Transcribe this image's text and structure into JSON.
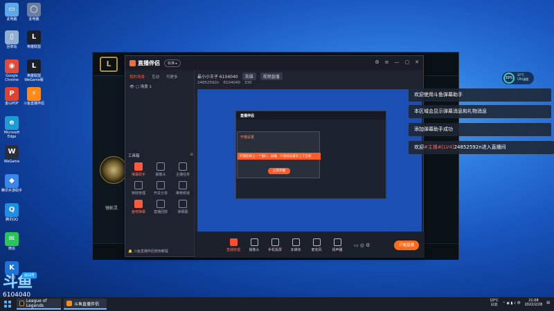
{
  "desktop": {
    "icons": [
      {
        "label": "此电脑",
        "color": "#5fa8e8",
        "glyph": "▭"
      },
      {
        "label": "此电脑",
        "color": "#6a7ea0",
        "glyph": "◯"
      },
      {
        "label": "回收站",
        "color": "#8fb0d0",
        "glyph": "▯"
      },
      {
        "label": "英雄联盟",
        "color": "#1b1f2a",
        "glyph": "L"
      },
      {
        "label": "Google Chrome",
        "color": "#e04a3a",
        "glyph": "◉"
      },
      {
        "label": "英雄联盟WeGame版",
        "color": "#1b1f2a",
        "glyph": "L"
      },
      {
        "label": "金山PDF",
        "color": "#e0432d",
        "glyph": "P"
      },
      {
        "label": "斗鱼直播伴侣",
        "color": "#ff8a1a",
        "glyph": "⚡"
      },
      {
        "label": "Microsoft Edge",
        "color": "#1e9ad6",
        "glyph": "e"
      },
      {
        "label": "WeGame",
        "color": "#2a2f3a",
        "glyph": "W"
      },
      {
        "label": "腾讯手游助手",
        "color": "#3a86e8",
        "glyph": "◆"
      },
      {
        "label": "腾讯QQ",
        "color": "#1f8fe6",
        "glyph": "Q"
      },
      {
        "label": "微信",
        "color": "#2ac45a",
        "glyph": "✉"
      },
      {
        "label": "酷狗",
        "color": "#1e72d8",
        "glyph": "K"
      }
    ]
  },
  "lol": {
    "logo": "L",
    "hero_text": "镜影灵",
    "bottom_text": ""
  },
  "zbbl": {
    "title": "直播伴侣",
    "version": "标准 ▸",
    "side_tabs": [
      "我的场景",
      "互动",
      "可更多"
    ],
    "scene": "场景 1",
    "tools_header": "工具箱",
    "tools": [
      {
        "label": "弹幕助手",
        "hot": true
      },
      {
        "label": "摄像头",
        "hot": false
      },
      {
        "label": "主播任务",
        "hot": false
      },
      {
        "label": "特效管理",
        "hot": false
      },
      {
        "label": "开关分享",
        "hot": false
      },
      {
        "label": "推荐频道",
        "hot": false
      },
      {
        "label": "鱼吧弹幕",
        "hot": true
      },
      {
        "label": "直播回放",
        "hot": false
      },
      {
        "label": "弹幕图",
        "hot": false
      }
    ],
    "side_footer": "斗鱼直播伴侣使用教程",
    "room_name": "最小小王子 6104040",
    "room_tag1": "英雄",
    "room_tag2": "视频直播",
    "room_id": "24852592n",
    "room_id2": "6104040",
    "room_num": "330",
    "controls": [
      {
        "label": "直播管理",
        "hot": true
      },
      {
        "label": "摄像头",
        "hot": false
      },
      {
        "label": "手机投屏",
        "hot": false
      },
      {
        "label": "多媒体",
        "hot": false
      },
      {
        "label": "麦克风",
        "hot": false
      },
      {
        "label": "扬声器",
        "hot": false
      }
    ],
    "start_label": "开始直播"
  },
  "nested": {
    "title": "直播伴侣",
    "dialog_title": "开播设置",
    "dialog_bar": "开播后将上一个窗口…加载 · 开播前设置好上下全屏",
    "dialog_button": "立即开播"
  },
  "danmu": {
    "msg1": "欢迎使用斗鱼弹幕助手",
    "msg2": "本区域会显示弹幕消息和礼物消息",
    "msg3": "添加弹幕助手成功",
    "msg4_pre": "欢迎",
    "msg4_hl": "#主播#[LV4]",
    "msg4_post": "24852592n进入直播间"
  },
  "perf": {
    "percent": "39%",
    "temp": "37°C",
    "label": "CPU温度"
  },
  "watermark": {
    "big": "斗鱼",
    "badge": "房间号",
    "number": "6104040"
  },
  "taskbar": {
    "app1": "League of Legends",
    "app2": "斗鱼直播伴侣",
    "weather": "10°C",
    "weather_sub": "以云",
    "time": "21:08",
    "date": "2022/2/28"
  }
}
